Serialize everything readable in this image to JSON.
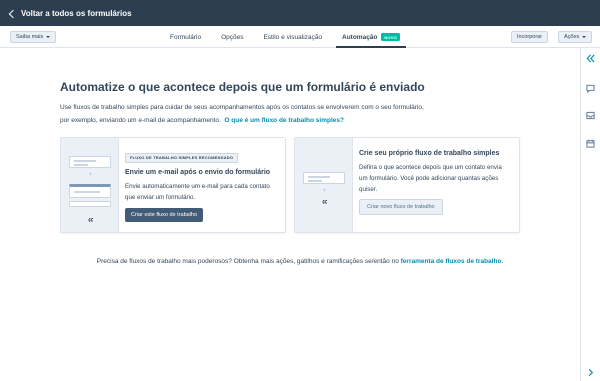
{
  "header": {
    "back_label": "Voltar a todos os formulários"
  },
  "toolbar": {
    "learn_more_label": "Saiba mais",
    "import_label": "Incorporar",
    "actions_label": "Ações"
  },
  "tabs": [
    {
      "label": "Formulário"
    },
    {
      "label": "Opções"
    },
    {
      "label": "Estilo e visualização"
    },
    {
      "label": "Automação",
      "badge": "NOVO"
    }
  ],
  "main": {
    "title": "Automatize o que acontece depois que um formulário é enviado",
    "intro": "Use fluxos de trabalho simples para cuidar de seus acompanhamentos após os contatos se envolverem com o seu formulário, por exemplo, enviando um e-mail de acompanhamento.",
    "intro_link": "O que é um fluxo de trabalho simples?"
  },
  "cards": [
    {
      "badge": "FLUXO DE TRABALHO SIMPLES RECOMENDADO",
      "title": "Envie um e-mail após o envio do formulário",
      "text": "Envie automaticamente um e-mail para cada contato que enviar um formulário.",
      "button": "Criar este fluxo de trabalho"
    },
    {
      "title": "Crie seu próprio fluxo de trabalho simples",
      "text": "Defina o que acontece depois que um contato envia um formulário. Você pode adicionar quantas ações quiser.",
      "button": "Criar novo fluxo de trabalho"
    }
  ],
  "footer": {
    "text": "Precisa de fluxos de trabalho mais poderosos? Obtenha mais ações, gatilhos e ramificações se/então no",
    "link": "ferramenta de fluxos de trabalho",
    "end": "."
  },
  "icons": [
    "chevron-left-icon",
    "caret-down-icon",
    "double-chevron-icon",
    "chat-icon",
    "inbox-icon",
    "calendar-icon",
    "chevron-right-icon"
  ],
  "colors": {
    "topbar": "#2d3e50",
    "accent": "#0091ae",
    "badge": "#00bda5",
    "button": "#425b76"
  }
}
